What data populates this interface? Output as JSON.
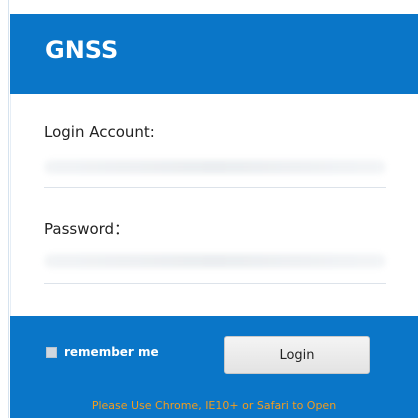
{
  "header": {
    "brand": "GNSS"
  },
  "form": {
    "account_label": "Login Account:",
    "account_value": "",
    "account_placeholder": "",
    "password_label": "Password：",
    "password_value": "",
    "password_placeholder": ""
  },
  "footer": {
    "remember_label": "remember me",
    "remember_checked": false,
    "login_label": "Login",
    "notice": "Please Use Chrome, IE10+ or Safari to Open"
  },
  "colors": {
    "primary": "#0a76c8",
    "notice": "#f39c1d"
  }
}
